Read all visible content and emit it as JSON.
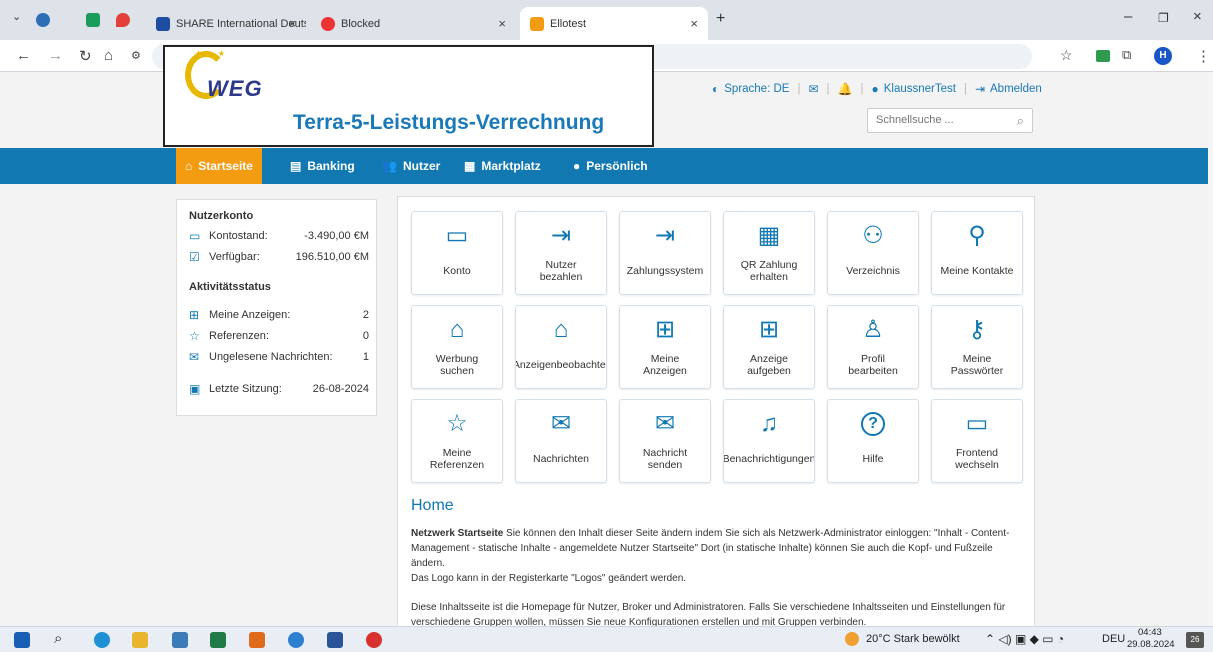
{
  "browser": {
    "tabs": [
      {
        "title": "SHARE International Deutschlar",
        "close": "×"
      },
      {
        "title": "Blocked",
        "close": "×"
      },
      {
        "title": "Ellotest",
        "close": "×"
      }
    ],
    "new_tab": "+",
    "window": {
      "minimize": "–",
      "maximize": "❐",
      "close": "×"
    },
    "nav": {
      "back": "←",
      "forward": "→",
      "reload": "↻",
      "home": "⌂"
    },
    "profile_initial": "H"
  },
  "header": {
    "logo_text": "WEG",
    "site_title": "Terra-5-Leistungs-Verrechnung",
    "language": "Sprache: DE",
    "user": "KlaussnerTest",
    "logout": "Abmelden",
    "search_placeholder": "Schnellsuche ..."
  },
  "nav": [
    {
      "label": "Startseite",
      "icon": "home-icon"
    },
    {
      "label": "Banking",
      "icon": "banking-icon"
    },
    {
      "label": "Nutzer",
      "icon": "users-icon"
    },
    {
      "label": "Marktplatz",
      "icon": "market-icon"
    },
    {
      "label": "Persönlich",
      "icon": "person-icon"
    }
  ],
  "sidebar": {
    "account_heading": "Nutzerkonto",
    "balance_label": "Kontostand:",
    "balance_value": "-3.490,00 €M",
    "available_label": "Verfügbar:",
    "available_value": "196.510,00 €M",
    "activity_heading": "Aktivitätsstatus",
    "ads_label": "Meine Anzeigen:",
    "ads_value": "2",
    "refs_label": "Referenzen:",
    "refs_value": "0",
    "unread_label": "Ungelesene Nachrichten:",
    "unread_value": "1",
    "last_session_label": "Letzte Sitzung:",
    "last_session_value": "26-08-2024"
  },
  "tiles": [
    {
      "label": "Konto",
      "icon": "wallet-icon"
    },
    {
      "label": "Nutzer\nbezahlen",
      "icon": "pay-user-icon"
    },
    {
      "label": "Zahlungssystem",
      "icon": "payment-system-icon"
    },
    {
      "label": "QR Zahlung\nerhalten",
      "icon": "qr-icon"
    },
    {
      "label": "Verzeichnis",
      "icon": "directory-icon"
    },
    {
      "label": "Meine Kontakte",
      "icon": "contacts-icon"
    },
    {
      "label": "Werbung\nsuchen",
      "icon": "bag-icon"
    },
    {
      "label": "Anzeigenbeobachter",
      "icon": "bag-icon"
    },
    {
      "label": "Meine\nAnzeigen",
      "icon": "basket-icon"
    },
    {
      "label": "Anzeige\naufgeben",
      "icon": "basket-icon"
    },
    {
      "label": "Profil\nbearbeiten",
      "icon": "profile-icon"
    },
    {
      "label": "Meine\nPasswörter",
      "icon": "key-icon"
    },
    {
      "label": "Meine\nReferenzen",
      "icon": "star-icon"
    },
    {
      "label": "Nachrichten",
      "icon": "mail-icon"
    },
    {
      "label": "Nachricht\nsenden",
      "icon": "mail-icon"
    },
    {
      "label": "Benachrichtigungen",
      "icon": "bell-icon"
    },
    {
      "label": "Hilfe",
      "icon": "help-icon"
    },
    {
      "label": "Frontend\nwechseln",
      "icon": "monitor-icon"
    }
  ],
  "content": {
    "title": "Home",
    "p1_bold": "Netzwerk Startseite",
    "p1": " Sie können den Inhalt dieser Seite ändern indem Sie sich als Netzwerk-Administrator einloggen: \"Inhalt - Content-Management - statische Inhalte - angemeldete Nutzer Startseite\" Dort (in statische Inhalte) können Sie auch die Kopf- und Fußzeile ändern.",
    "p2": "Das Logo kann in der Registerkarte \"Logos\" geändert werden.",
    "p3": "Diese Inhaltsseite ist die Homepage für Nutzer, Broker und Administratoren. Falls Sie verschiedene Inhaltsseiten und Einstellungen für verschiedene Gruppen wollen, müssen Sie neue Konfigurationen erstellen und mit Gruppen verbinden."
  },
  "taskbar": {
    "weather": "20°C  Stark bewölkt",
    "lang": "DEU",
    "time": "04:43",
    "date": "29.08.2024",
    "notif_count": "26"
  }
}
